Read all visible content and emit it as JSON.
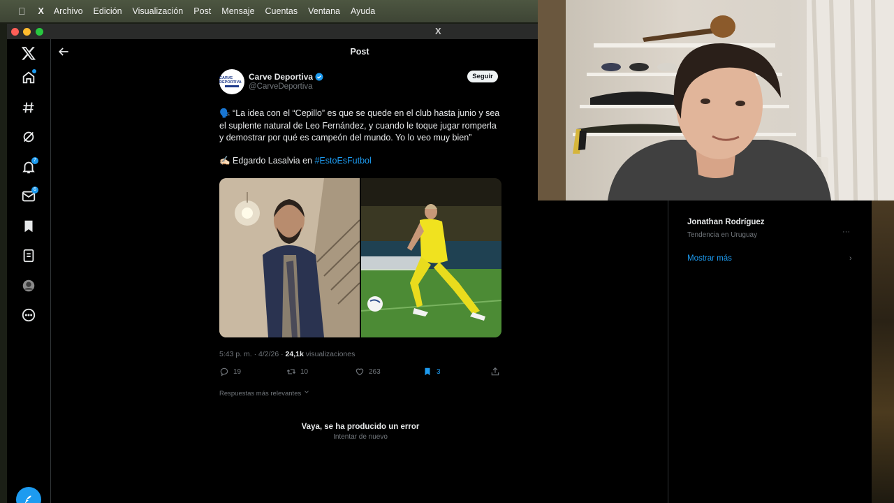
{
  "menubar": {
    "app": "X",
    "items": [
      "Archivo",
      "Edición",
      "Visualización",
      "Post",
      "Mensaje",
      "Cuentas",
      "Ventana",
      "Ayuda"
    ]
  },
  "window": {
    "title": "X"
  },
  "nav": {
    "items": [
      {
        "icon": "x-logo-icon"
      },
      {
        "icon": "home-icon"
      },
      {
        "icon": "explore-icon"
      },
      {
        "icon": "grok-icon"
      },
      {
        "icon": "notifications-icon",
        "badge": "7"
      },
      {
        "icon": "messages-icon",
        "badge": "6"
      },
      {
        "icon": "bookmarks-icon"
      },
      {
        "icon": "lists-icon"
      },
      {
        "icon": "profile-icon"
      },
      {
        "icon": "more-icon"
      }
    ]
  },
  "header": {
    "title": "Post"
  },
  "post": {
    "avatar_text": "CARVE DEPORTIVA",
    "author": "Carve Deportiva",
    "handle": "@CarveDeportiva",
    "follow_label": "Seguir",
    "quote": "🗣️ “La idea con el “Cepillo” es que se quede en el club hasta junio y sea el suplente natural de Leo Fernández, y cuando le toque jugar romperla y demostrar por qué es campeón del mundo. Yo lo veo muy bien”",
    "credit_prefix": "✍🏻 Edgardo Lasalvia en ",
    "hashtag": "#EstoEsFutbol",
    "time": "5:43 p. m. · 4/2/26 · ",
    "views_count": "24,1k",
    "views_label": " visualizaciones",
    "replies": "19",
    "reposts": "10",
    "likes": "263",
    "bookmarks": "3",
    "sort_label": "Respuestas más relevantes",
    "error_title": "Vaya, se ha producido un error",
    "retry_label": "Intentar de nuevo"
  },
  "sidebar": {
    "trend_name": "Jonathan Rodríguez",
    "trend_sub": "Tendencia en Uruguay",
    "more_glyph": "···",
    "show_more": "Mostrar más",
    "show_more_chevron": "›"
  },
  "colors": {
    "accent": "#1d9bf0",
    "background": "#000000",
    "text": "#e7e9ea",
    "muted": "#71767b"
  }
}
